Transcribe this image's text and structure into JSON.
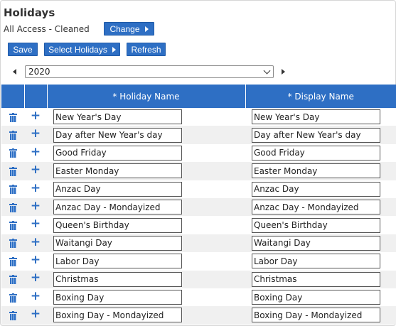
{
  "page": {
    "title": "Holidays",
    "subtitle": "All Access - Cleaned"
  },
  "toolbar": {
    "change_label": "Change",
    "save_label": "Save",
    "select_holidays_label": "Select Holidays",
    "refresh_label": "Refresh"
  },
  "year_select": {
    "value": "2020"
  },
  "table": {
    "columns": [
      "* Holiday Name",
      "* Display Name"
    ],
    "rows": [
      {
        "holiday_name": "New Year's Day",
        "display_name": "New Year's Day"
      },
      {
        "holiday_name": "Day after New Year's day",
        "display_name": "Day after New Year's day"
      },
      {
        "holiday_name": "Good Friday",
        "display_name": "Good Friday"
      },
      {
        "holiday_name": "Easter Monday",
        "display_name": "Easter Monday"
      },
      {
        "holiday_name": "Anzac Day",
        "display_name": "Anzac Day"
      },
      {
        "holiday_name": "Anzac Day - Mondayized",
        "display_name": "Anzac Day - Mondayized"
      },
      {
        "holiday_name": "Queen's Birthday",
        "display_name": "Queen's Birthday"
      },
      {
        "holiday_name": "Waitangi Day",
        "display_name": "Waitangi Day"
      },
      {
        "holiday_name": "Labor Day",
        "display_name": "Labor Day"
      },
      {
        "holiday_name": "Christmas",
        "display_name": "Christmas"
      },
      {
        "holiday_name": "Boxing Day",
        "display_name": "Boxing Day"
      },
      {
        "holiday_name": "Boxing Day - Mondayized",
        "display_name": "Boxing Day - Mondayized"
      }
    ]
  },
  "icons": {
    "delete": "trash-icon",
    "add": "plus-icon",
    "prev": "caret-left-icon",
    "next": "caret-right-icon"
  },
  "colors": {
    "accent": "#2e6fc4",
    "row_alt": "#f0f0f0"
  }
}
